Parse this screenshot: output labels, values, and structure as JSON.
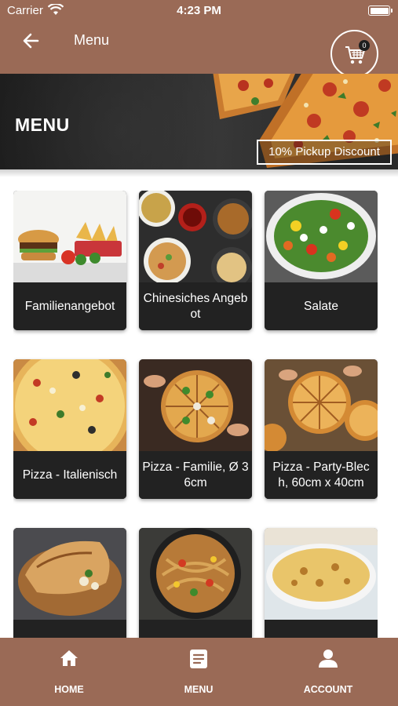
{
  "status": {
    "carrier": "Carrier",
    "time": "4:23 PM"
  },
  "header": {
    "title": "Menu",
    "cart_count": "0"
  },
  "banner": {
    "title": "MENU",
    "discount": "10% Pickup Discount"
  },
  "categories": [
    {
      "label": "Familienangebot"
    },
    {
      "label": "Chinesiches Angebot"
    },
    {
      "label": "Salate"
    },
    {
      "label": "Pizza - Italienisch"
    },
    {
      "label": "Pizza - Familie, Ø 36cm"
    },
    {
      "label": "Pizza - Party-Blech, 60cm x 40cm"
    },
    {
      "label": ""
    },
    {
      "label": ""
    },
    {
      "label": ""
    }
  ],
  "tabs": [
    {
      "label": "HOME",
      "icon": "home-icon"
    },
    {
      "label": "MENU",
      "icon": "menu-list-icon"
    },
    {
      "label": "ACCOUNT",
      "icon": "account-icon"
    }
  ],
  "colors": {
    "brand": "#9a6a56",
    "card_label_bg": "#222222",
    "text": "#ffffff"
  }
}
